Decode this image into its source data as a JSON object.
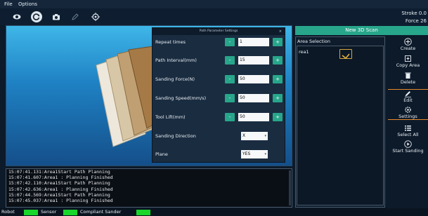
{
  "menu": {
    "file": "File",
    "options": "Options"
  },
  "toolbar": {
    "icons": [
      "eye-icon",
      "refresh-icon",
      "camera-icon",
      "pen-icon",
      "target-icon"
    ]
  },
  "stats": {
    "stroke": "Stroke 0.0",
    "force": "Force  26"
  },
  "dialog": {
    "title": "Path Parameter Settings",
    "close": "×",
    "rows": [
      {
        "label": "Repeat times",
        "value": "1"
      },
      {
        "label": "Path Interval(mm)",
        "value": "15"
      },
      {
        "label": "Sanding Force(N)",
        "value": "50"
      },
      {
        "label": "Sanding Speed(mm/s)",
        "value": "50"
      },
      {
        "label": "Tool Lift(mm)",
        "value": "50"
      }
    ],
    "direction": {
      "label": "Sanding Direction",
      "value": "X"
    },
    "plane": {
      "label": "Plane",
      "value": "YES"
    },
    "minus": "-",
    "plus": "+"
  },
  "log": {
    "lines": [
      "15:07:41.131:Area1Start Path Planning",
      "15:07:41.607:Area1 : Planning Finished",
      "15:07:42.110:Area1Start Path Planning",
      "15:07:42.636:Area1 : Planning Finished",
      "15:07:44.569:Area1Start Path Planning",
      "15:07:45.037:Area1 : Planning Finished"
    ]
  },
  "scan_button": "New 3D Scan",
  "area": {
    "title": "Area Selection",
    "item": "rea1"
  },
  "side": {
    "create": "Create",
    "copy": "Copy Area",
    "delete": "Delete",
    "edit": "Edit",
    "settings": "Settings",
    "select_all": "Select All",
    "start": "Start Sanding"
  },
  "status": {
    "robot": "Robot",
    "sensor": "Sensor",
    "compliant": "Compliant Sander"
  },
  "colors": {
    "accent": "#27a68b",
    "led": "#18d62a",
    "highlight": "#e8882a"
  }
}
